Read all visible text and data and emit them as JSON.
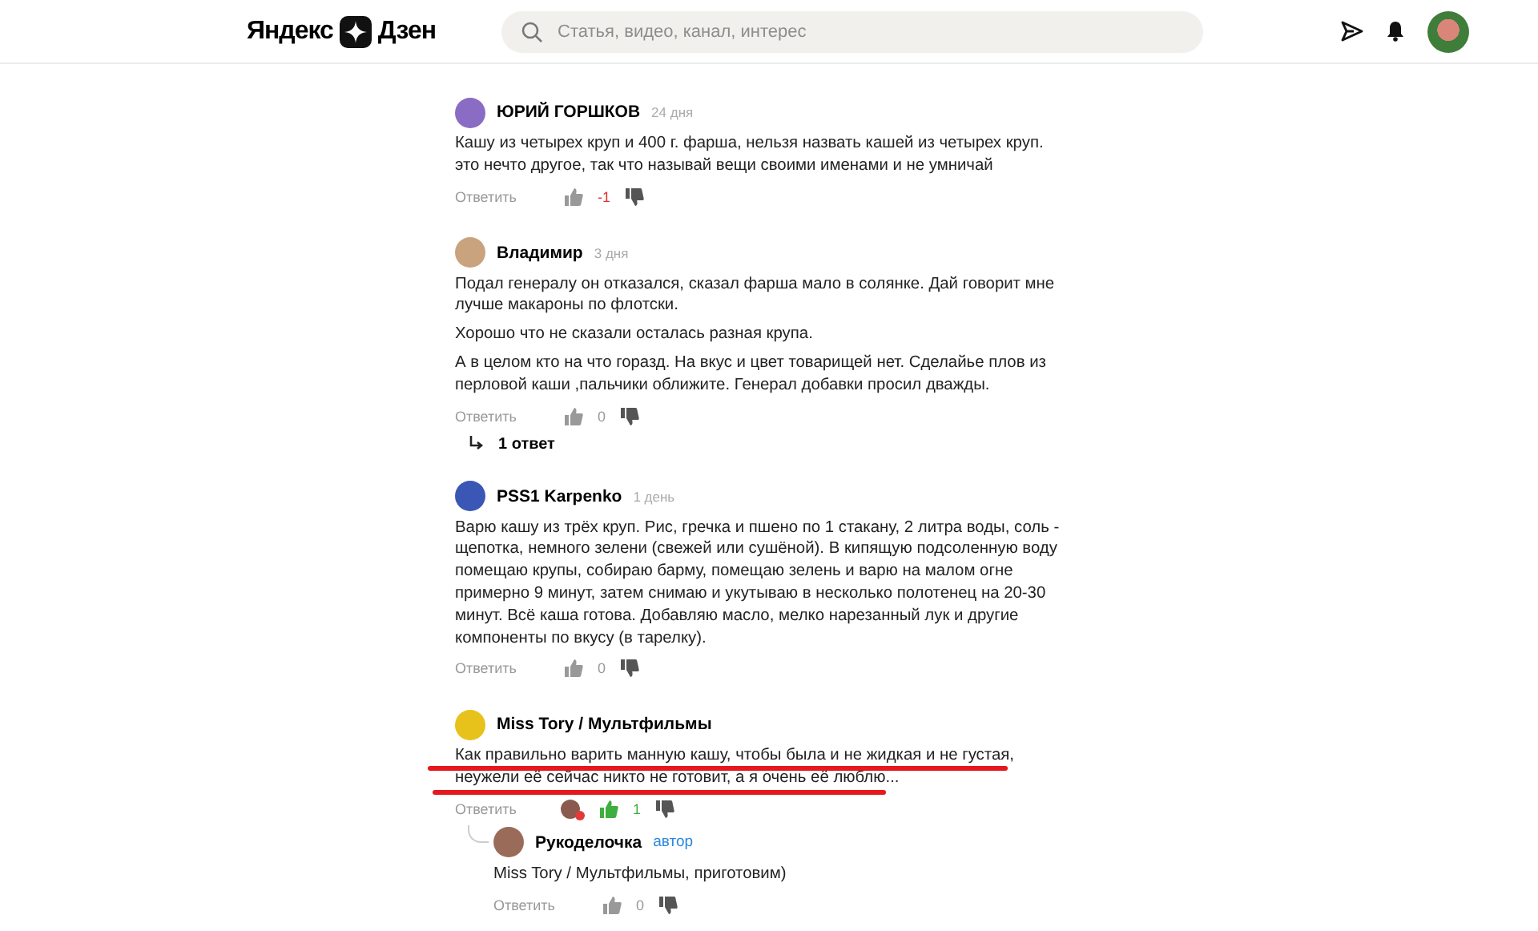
{
  "header": {
    "logo_left": "Яндекс",
    "logo_right": "Дзен",
    "search": {
      "placeholder": "Статья, видео, канал, интерес"
    }
  },
  "comments": [
    {
      "author": "ЮРИЙ ГОРШКОВ",
      "time": "24 дня",
      "avatar": {
        "color": "#8b6cc4"
      },
      "paragraphs": [
        "Кашу из четырех круп и 400 г. фарша, нельзя назвать кашей из четырех круп. это нечто другое, так что называй вещи своими именами и не умничай"
      ],
      "reply_label": "Ответить",
      "score": {
        "text": "-1",
        "color": "#e0312f"
      },
      "liked": false,
      "author_liked": false,
      "marked": false
    },
    {
      "author": "Владимир",
      "time": "3 дня",
      "avatar": {
        "color": "#c9a27e"
      },
      "paragraphs": [
        "Подал генералу он отказался, сказал фарша мало в солянке. Дай говорит мне лучше макароны по флотски.",
        "Хорошо что не сказали осталась разная крупа.",
        "А в целом кто на что горазд. На вкус и цвет товарищей нет. Сделайье плов из перловой каши ,пальчики оближите. Генерал добавки просил дважды."
      ],
      "reply_label": "Ответить",
      "score": {
        "text": "0",
        "color": "#999999"
      },
      "liked": false,
      "author_liked": false,
      "marked": false,
      "replies_link": "1 ответ"
    },
    {
      "author": "PSS1 Karpenko",
      "time": "1 день",
      "avatar": {
        "color": "#3a57b5"
      },
      "paragraphs": [
        "Варю кашу из трёх круп. Рис, гречка и пшено по 1 стакану, 2 литра воды, соль - щепотка, немного зелени (свежей или сушёной). В кипящую подсоленную воду помещаю крупы, собираю барму, помещаю зелень и варю на малом огне примерно 9 минут, затем снимаю и укутываю в несколько полотенец на 20-30 минут. Всё каша готова. Добавляю масло, мелко нарезанный лук и другие компоненты по вкусу (в тарелку)."
      ],
      "reply_label": "Ответить",
      "score": {
        "text": "0",
        "color": "#999999"
      },
      "liked": false,
      "author_liked": false,
      "marked": false
    },
    {
      "author": "Miss Tory / Мультфильмы",
      "avatar": {
        "color": "#e6c21a"
      },
      "paragraphs": [
        "Как правильно варить манную кашу, чтобы была и не жидкая и не густая, неужели её сейчас никто не готовит, а я очень её люблю..."
      ],
      "reply_label": "Ответить",
      "score": {
        "text": "1",
        "color": "#3eae3e"
      },
      "liked": true,
      "author_liked": true,
      "marked": true,
      "replies": [
        {
          "author": "Рукоделочка",
          "badge": "автор",
          "avatar": {
            "color": "#9b6b5a"
          },
          "paragraphs": [
            "Miss Tory / Мультфильмы, приготовим)"
          ],
          "reply_label": "Ответить",
          "score": {
            "text": "0",
            "color": "#999999"
          },
          "liked": false,
          "author_liked": false,
          "marked": false
        }
      ]
    }
  ]
}
